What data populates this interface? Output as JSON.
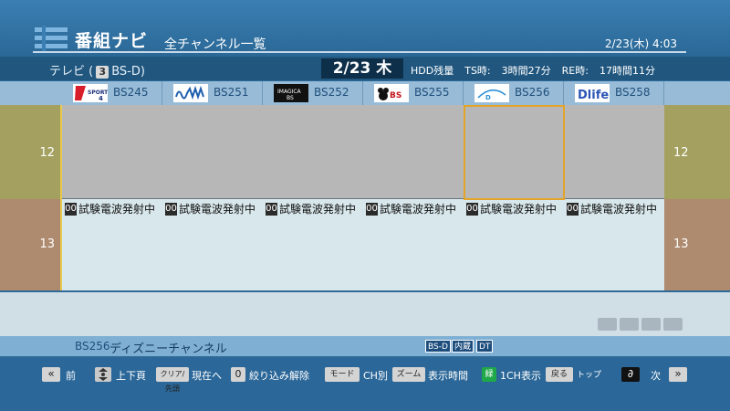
{
  "header": {
    "app_title": "番組ナビ",
    "view_title": "全チャンネル一覧",
    "datetime": "2/23(木) 4:03"
  },
  "info": {
    "tv_label": "テレビ (",
    "tv_num": "3",
    "tv_band": "BS-D)",
    "date": "2/23 木",
    "hdd_label": "HDD残量",
    "ts_label": "TS時:",
    "ts_value": "3時間27分",
    "re_label": "RE時:",
    "re_value": "17時間11分"
  },
  "channels": [
    {
      "number": "BS245",
      "logo": "sports4-logo",
      "logo_text": "SPORTS"
    },
    {
      "number": "BS251",
      "logo": "bs251-logo",
      "logo_text": "∿WW"
    },
    {
      "number": "BS252",
      "logo": "imagica-logo",
      "logo_text": "IMAGICA BS"
    },
    {
      "number": "BS255",
      "logo": "bs255-logo",
      "logo_text": "BS"
    },
    {
      "number": "BS256",
      "logo": "disney-logo",
      "logo_text": "Disney"
    },
    {
      "number": "BS258",
      "logo": "dlife-logo",
      "logo_text": "Dlife"
    }
  ],
  "hours": [
    "12",
    "13"
  ],
  "programs": [
    {
      "time": "00",
      "title": "試験電波発射中"
    },
    {
      "time": "00",
      "title": "試験電波発射中"
    },
    {
      "time": "00",
      "title": "試験電波発射中"
    },
    {
      "time": "00",
      "title": "試験電波発射中"
    },
    {
      "time": "00",
      "title": "試験電波発射中"
    },
    {
      "time": "00",
      "title": "試験電波発射中"
    }
  ],
  "selected": {
    "channel": "BS256",
    "name": "ディズニーチャンネル",
    "tags": [
      "BS-D",
      "内蔵",
      "DT"
    ]
  },
  "footer": {
    "prev_label": "前",
    "page_label": "上下頁",
    "clear_btn": "クリア/先頭",
    "now_label": "現在へ",
    "zero_btn": "0",
    "filter_label": "絞り込み解除",
    "mode_btn": "モード",
    "ch_label": "CH別",
    "zoom_btn": "ズーム",
    "time_label": "表示時間",
    "green_btn": "緑",
    "onech_label": "1CH表示",
    "back_btn": "戻る",
    "top_label": "トップ",
    "next_label": "次"
  },
  "colors": {
    "cursor": "#e2a52a",
    "hour_12_bg": "#a4a060",
    "hour_13_bg": "#ae8a6e"
  }
}
